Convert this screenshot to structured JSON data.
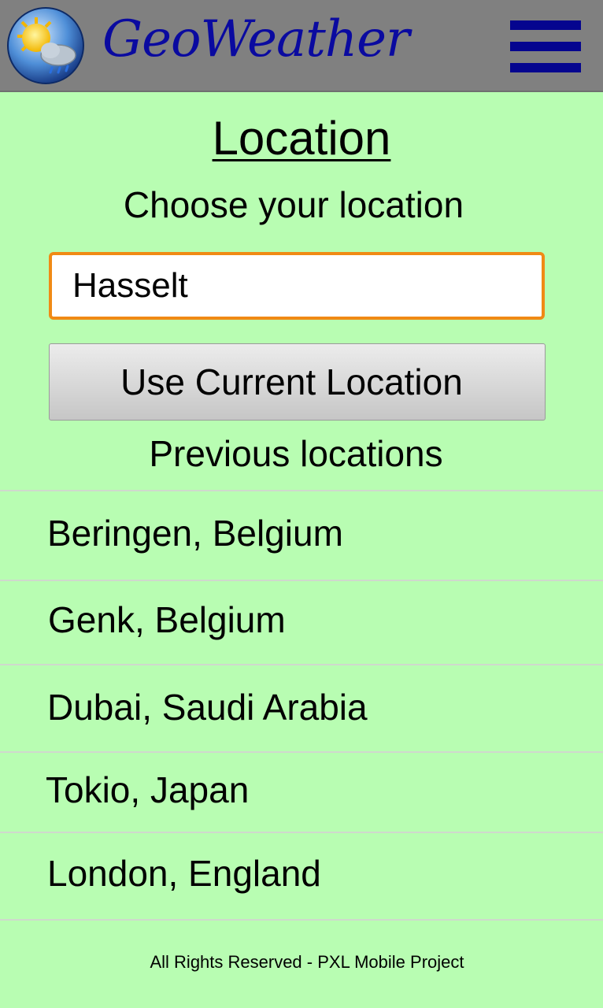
{
  "header": {
    "app_name": "GeoWeather",
    "logo_icon": "sun-cloud-rain-icon",
    "menu_icon": "hamburger-menu-icon",
    "brand_color": "#0a0aa0",
    "bar_color": "#808080"
  },
  "main": {
    "title": "Location",
    "subtitle": "Choose your location",
    "location_input": {
      "value": "Hasselt",
      "border_color": "#f08a15"
    },
    "current_location_button": "Use Current Location",
    "previous_heading": "Previous locations",
    "previous_locations": [
      "Beringen, Belgium",
      "Genk, Belgium",
      "Dubai, Saudi Arabia",
      "Tokio, Japan",
      "London, England"
    ],
    "background_color": "#b8fdb2"
  },
  "footer": {
    "text": "All Rights Reserved - PXL Mobile Project"
  }
}
